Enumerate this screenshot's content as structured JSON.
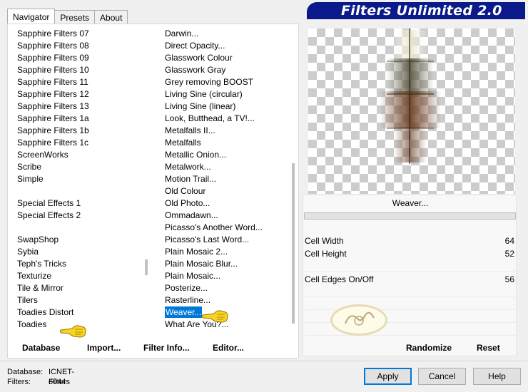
{
  "tabs": [
    "Navigator",
    "Presets",
    "About"
  ],
  "banner_title": "Filters Unlimited 2.0",
  "categories": [
    "Sapphire Filters 07",
    "Sapphire Filters 08",
    "Sapphire Filters 09",
    "Sapphire Filters 10",
    "Sapphire Filters 11",
    "Sapphire Filters 12",
    "Sapphire Filters 13",
    "Sapphire Filters 1a",
    "Sapphire Filters 1b",
    "Sapphire Filters 1c",
    "ScreenWorks",
    "Scribe",
    "Simple",
    "",
    "Special Effects 1",
    "Special Effects 2",
    "",
    "SwapShop",
    "Sybia",
    "Teph's Tricks",
    "Texturize",
    "Tile & Mirror",
    "Tilers",
    "Toadies Distort",
    "Toadies"
  ],
  "filters": [
    "Darwin...",
    "Direct Opacity...",
    "Glasswork Colour",
    "Glasswork Gray",
    "Grey removing BOOST",
    "Living Sine (circular)",
    "Living Sine (linear)",
    "Look, Butthead, a TV!...",
    "Metalfalls II...",
    "Metalfalls",
    "Metallic Onion...",
    "Metalwork...",
    "Motion Trail...",
    "Old Colour",
    "Old Photo...",
    "Ommadawn...",
    "Picasso's Another Word...",
    "Picasso's Last Word...",
    "Plain Mosaic 2...",
    "Plain Mosaic Blur...",
    "Plain Mosaic...",
    "Posterize...",
    "Rasterline...",
    "Weaver...",
    "What Are You?..."
  ],
  "selected_filter": "Weaver...",
  "nav_buttons": {
    "database": "Database",
    "import": "Import...",
    "filter_info": "Filter Info...",
    "editor": "Editor..."
  },
  "current_filter_name": "Weaver...",
  "params": [
    {
      "label": "Cell Width",
      "value": "64"
    },
    {
      "label": "Cell Height",
      "value": "52"
    },
    {
      "label": "Cell Edges On/Off",
      "value": "56"
    }
  ],
  "randomize_label": "Randomize",
  "reset_label": "Reset",
  "footer": {
    "database_label": "Database:",
    "database_value": "ICNET-Filters",
    "filters_label": "Filters:",
    "filters_value": "6044"
  },
  "apply_label": "Apply",
  "cancel_label": "Cancel",
  "help_label": "Help",
  "colors": {
    "selection": "#0078d7",
    "banner": "#0a1a8a"
  }
}
